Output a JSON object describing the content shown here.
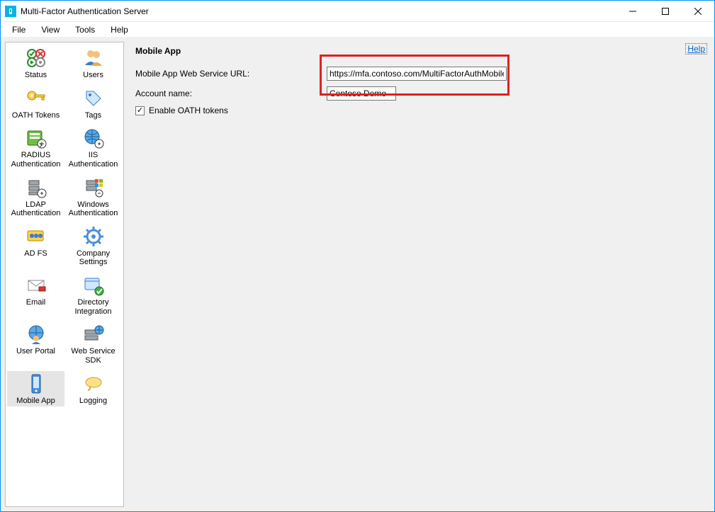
{
  "window": {
    "title": "Multi-Factor Authentication Server"
  },
  "menu": {
    "file": "File",
    "view": "View",
    "tools": "Tools",
    "help": "Help"
  },
  "sidebar": {
    "items": [
      {
        "label": "Status"
      },
      {
        "label": "Users"
      },
      {
        "label": "OATH Tokens"
      },
      {
        "label": "Tags"
      },
      {
        "label": "RADIUS Authentication"
      },
      {
        "label": "IIS Authentication"
      },
      {
        "label": "LDAP Authentication"
      },
      {
        "label": "Windows Authentication"
      },
      {
        "label": "AD FS"
      },
      {
        "label": "Company Settings"
      },
      {
        "label": "Email"
      },
      {
        "label": "Directory Integration"
      },
      {
        "label": "User Portal"
      },
      {
        "label": "Web Service SDK"
      },
      {
        "label": "Mobile App"
      },
      {
        "label": "Logging"
      }
    ]
  },
  "content": {
    "heading": "Mobile App",
    "help": "Help",
    "url_label": "Mobile App Web Service URL:",
    "url_value": "https://mfa.contoso.com/MultiFactorAuthMobileApp",
    "account_label": "Account name:",
    "account_value": "Contoso Demo",
    "oath_label": "Enable OATH tokens",
    "oath_checked": true
  }
}
